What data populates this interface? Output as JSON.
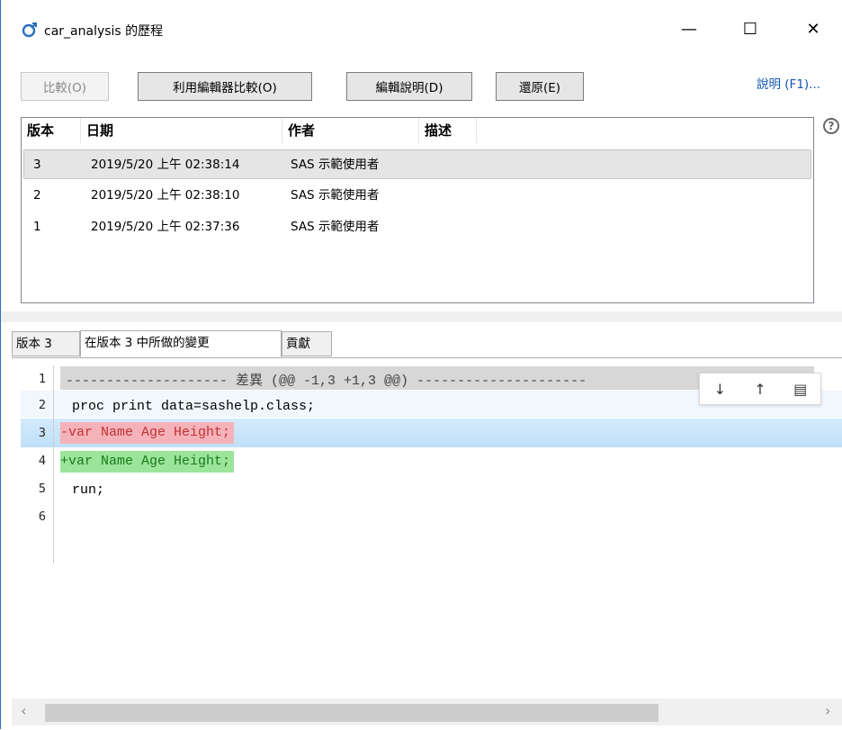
{
  "window": {
    "title": "car_analysis 的歷程",
    "minimize": "—",
    "maximize": "☐",
    "close": "✕"
  },
  "toolbar": {
    "compare": "比較(O)",
    "compare_editor": "利用編輯器比較(O)",
    "edit_desc": "編輯說明(D)",
    "restore": "還原(E)",
    "help": "說明 (F1)..."
  },
  "history_table": {
    "columns": [
      "版本",
      "日期",
      "作者",
      "描述"
    ],
    "rows": [
      {
        "version": "3",
        "date": "2019/5/20 上午 02:38:14",
        "author": "SAS 示範使用者",
        "desc": ""
      },
      {
        "version": "2",
        "date": "2019/5/20 上午 02:38:10",
        "author": "SAS 示範使用者",
        "desc": ""
      },
      {
        "version": "1",
        "date": "2019/5/20 上午 02:37:36",
        "author": "SAS 示範使用者",
        "desc": ""
      }
    ]
  },
  "tabs": [
    "版本 3",
    "在版本 3 中所做的變更",
    "貢獻"
  ],
  "editor": {
    "line_numbers": [
      "1",
      "2",
      "3",
      "4",
      "5",
      "6"
    ],
    "hunk_header": "-------------------- 差異 (@@ -1,3 +1,3 @@) ---------------------",
    "lines": [
      " proc print data=sashelp.class;",
      "-var Name Age Height;",
      "+var Name Age Height;",
      " run;"
    ],
    "nav": {
      "down": "↓",
      "up": "↑",
      "doc": "▤"
    }
  },
  "scrollbar": {
    "left": "‹",
    "right": "›"
  },
  "colors": {
    "accent": "#2b6fbf",
    "deleted_bg": "#f6b2b9",
    "added_bg": "#9be59b",
    "selection": "#e5e5e5"
  }
}
